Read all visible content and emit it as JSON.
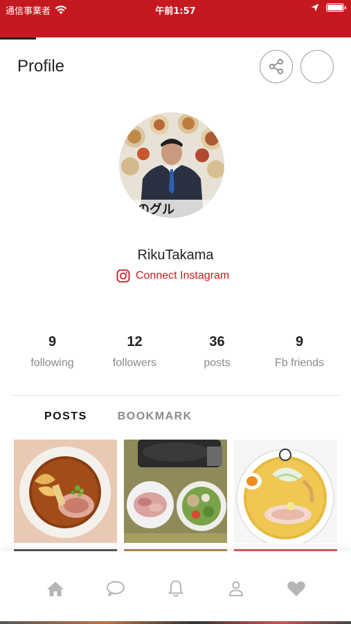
{
  "status_bar": {
    "carrier": "通信事業者",
    "time": "午前1:57"
  },
  "header": {
    "title": "Profile"
  },
  "profile": {
    "username": "RikuTakama",
    "connect_instagram": "Connect Instagram",
    "avatar_caption": "独のグル"
  },
  "stats": [
    {
      "value": "9",
      "label": "following"
    },
    {
      "value": "12",
      "label": "followers"
    },
    {
      "value": "36",
      "label": "posts"
    },
    {
      "value": "9",
      "label": "Fb friends"
    }
  ],
  "tabs": {
    "posts": "POSTS",
    "bookmark": "BOOKMARK"
  },
  "posts": [
    {
      "subject": "shoyu ramen"
    },
    {
      "subject": "hot pot ingredients"
    },
    {
      "subject": "miso ramen"
    }
  ],
  "bottom_nav": [
    {
      "icon": "home-icon"
    },
    {
      "icon": "chat-icon"
    },
    {
      "icon": "bell-icon"
    },
    {
      "icon": "person-icon"
    },
    {
      "icon": "heart-icon"
    }
  ],
  "colors": {
    "brand_red": "#c41a1f",
    "nav_icon_gray": "#b5b5b5"
  }
}
